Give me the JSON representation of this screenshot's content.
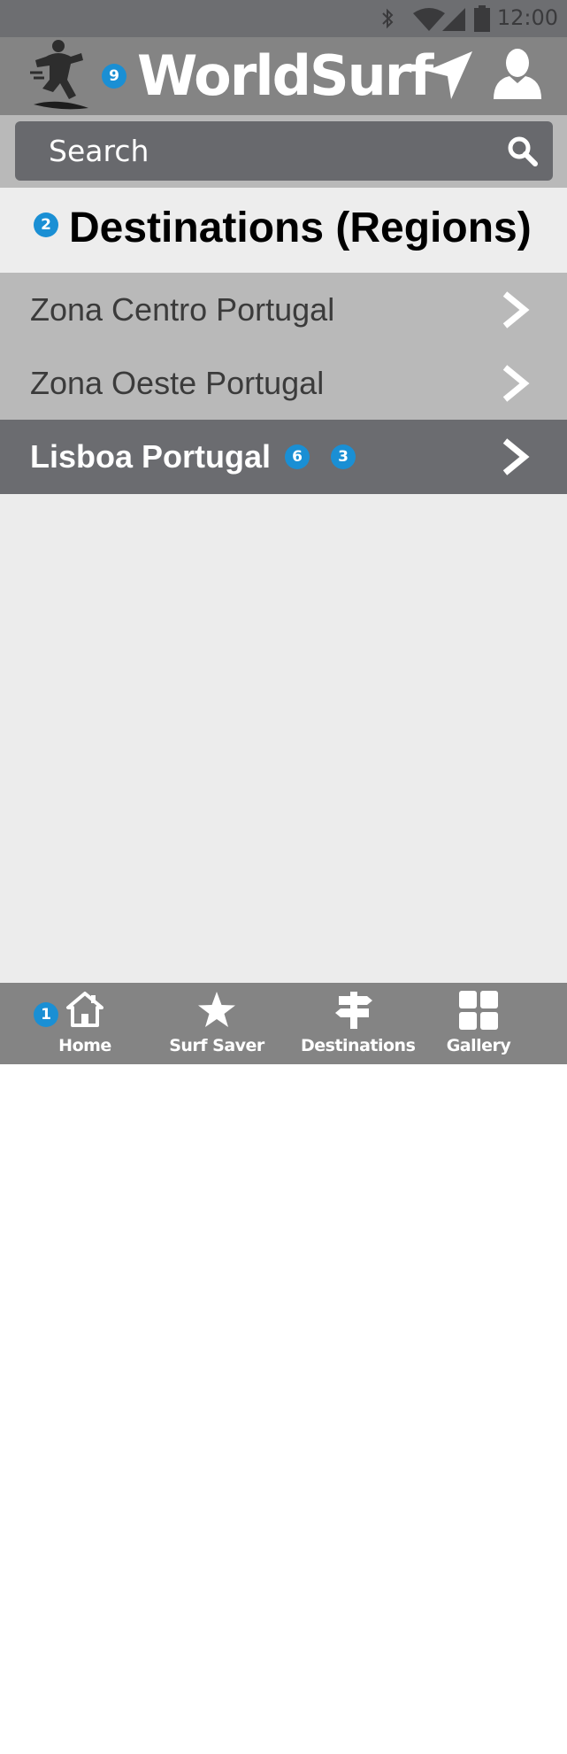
{
  "status_bar": {
    "time": "12:00",
    "icons": [
      "bluetooth-icon",
      "wifi-icon",
      "signal-icon",
      "battery-icon"
    ]
  },
  "header": {
    "title": "WorldSurf",
    "badge": "9",
    "icons": [
      "surfer-logo",
      "location-arrow-icon",
      "user-icon"
    ]
  },
  "search": {
    "placeholder": "Search",
    "icon": "search-icon"
  },
  "section": {
    "title": "Destinations (Regions)",
    "badge": "2"
  },
  "regions": [
    {
      "label": "Zona Centro Portugal",
      "selected": false
    },
    {
      "label": "Zona Oeste Portugal",
      "selected": false
    },
    {
      "label": "Lisboa Portugal",
      "selected": true,
      "badges": [
        "6",
        "3"
      ]
    }
  ],
  "bottom_nav": {
    "badge": "1",
    "items": [
      {
        "label": "Home",
        "icon": "home-icon"
      },
      {
        "label": "Surf Saver",
        "icon": "star-icon"
      },
      {
        "label": "Destinations",
        "icon": "signpost-icon"
      },
      {
        "label": "Gallery",
        "icon": "grid-icon"
      }
    ]
  },
  "colors": {
    "status_bar": "#6d6e71",
    "header": "#848484",
    "search_field": "#68696d",
    "list_row": "#b9b9b9",
    "selected_row": "#6b6c70",
    "background": "#ececec",
    "badge": "#1a8fd4"
  }
}
